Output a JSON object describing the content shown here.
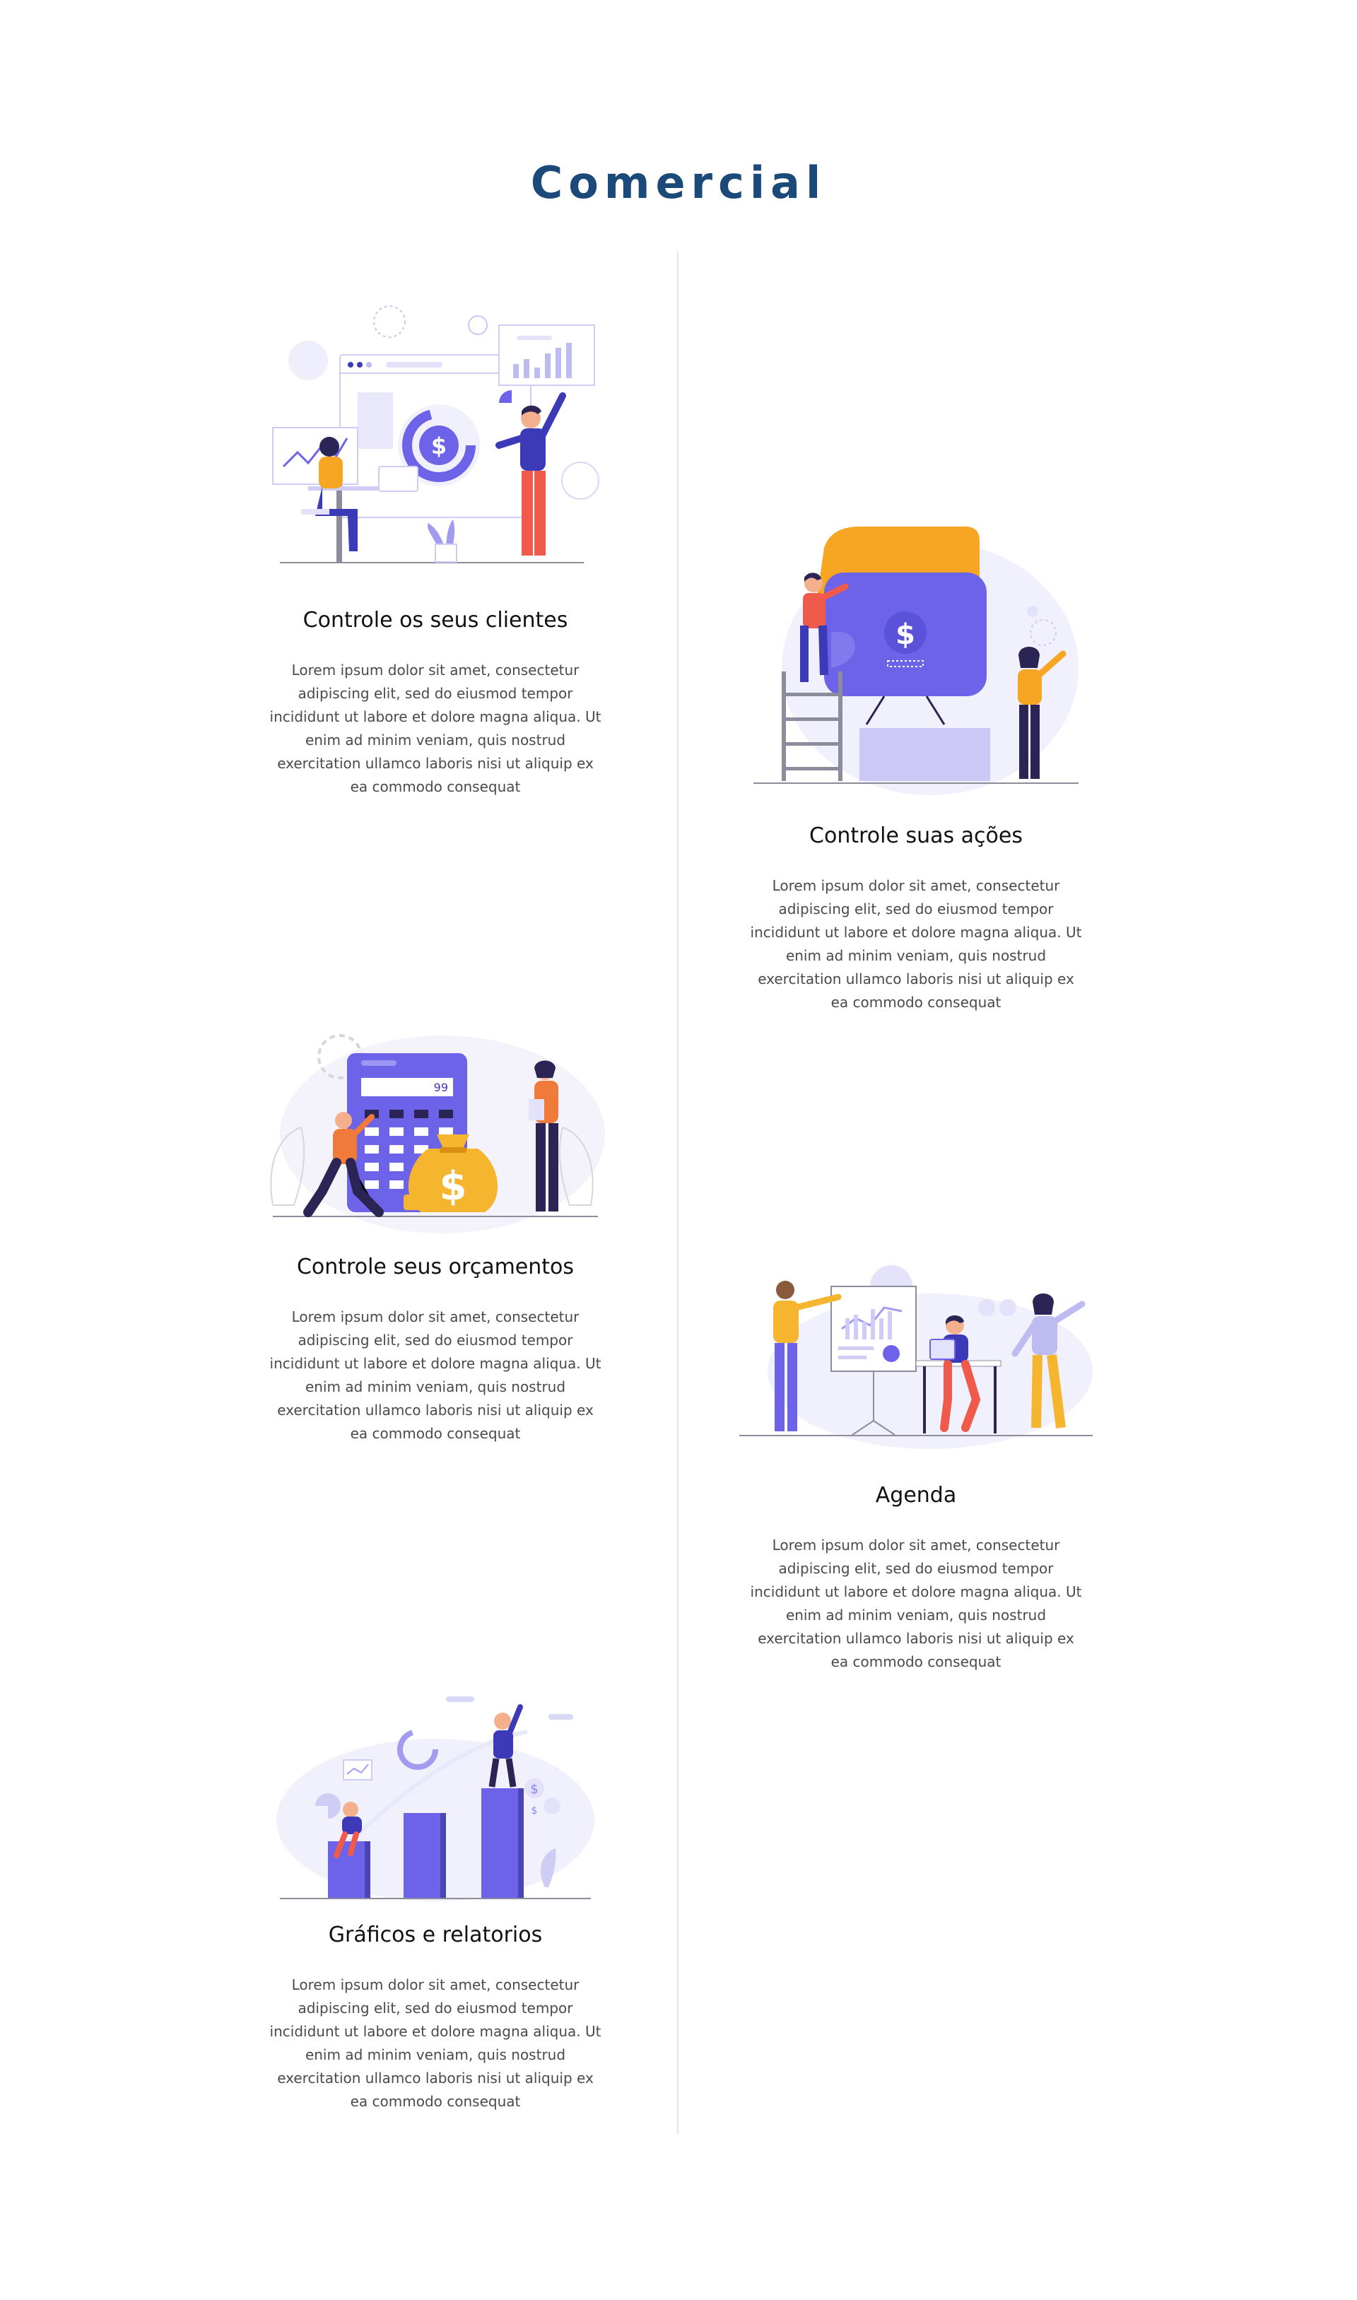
{
  "section": {
    "title": "Comercial"
  },
  "features": [
    {
      "id": "clientes",
      "title": "Controle os seus clientes",
      "text": "Lorem ipsum dolor sit amet, consectetur adipiscing elit, sed do eiusmod tempor incididunt ut labore et dolore magna aliqua. Ut enim ad minim veniam, quis nostrud exercitation ullamco laboris nisi ut aliquip ex ea commodo consequat"
    },
    {
      "id": "acoes",
      "title": "Controle suas ações",
      "text": "Lorem ipsum dolor sit amet, consectetur adipiscing elit, sed do eiusmod tempor incididunt ut labore et dolore magna aliqua. Ut enim ad minim veniam, quis nostrud exercitation ullamco laboris nisi ut aliquip ex ea commodo consequat"
    },
    {
      "id": "orcamentos",
      "title": "Controle seus orçamentos",
      "text": "Lorem ipsum dolor sit amet, consectetur adipiscing elit, sed do eiusmod tempor incididunt ut labore et dolore magna aliqua. Ut enim ad minim veniam, quis nostrud exercitation ullamco laboris nisi ut aliquip ex ea commodo consequat"
    },
    {
      "id": "agenda",
      "title": "Agenda",
      "text": "Lorem ipsum dolor sit amet, consectetur adipiscing elit, sed do eiusmod tempor incididunt ut labore et dolore magna aliqua. Ut enim ad minim veniam, quis nostrud exercitation ullamco laboris nisi ut aliquip ex ea commodo consequat"
    },
    {
      "id": "graficos",
      "title": "Gráficos e relatorios",
      "text": "Lorem ipsum dolor sit amet, consectetur adipiscing elit, sed do eiusmod tempor incididunt ut labore et dolore magna aliqua. Ut enim ad minim veniam, quis nostrud exercitation ullamco laboris nisi ut aliquip ex ea commodo consequat"
    }
  ],
  "calculator_display": "99",
  "icons": [
    "customers-illustration",
    "actions-illustration",
    "budget-illustration",
    "schedule-illustration",
    "reports-illustration"
  ],
  "colors": {
    "title": "#1b4a7a",
    "accent_purple": "#6c63e8",
    "accent_orange": "#f6a623",
    "accent_red": "#f05a4a",
    "text": "#4a4a4a",
    "divider": "#e6e6e6"
  }
}
